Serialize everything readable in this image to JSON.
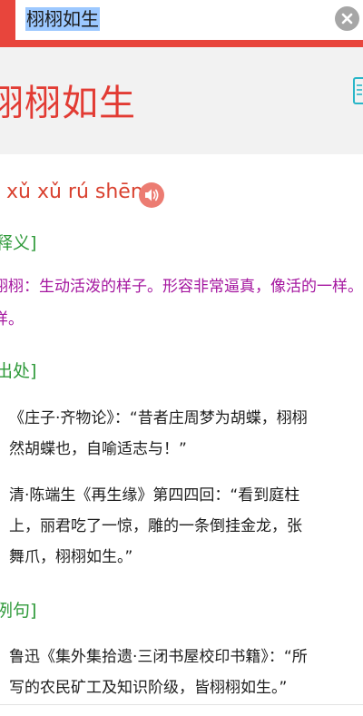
{
  "search": {
    "query": "栩栩如生"
  },
  "header": {
    "title": "栩栩如生"
  },
  "pinyin": {
    "text": "xǔ xǔ rú shēng"
  },
  "sections": {
    "definition_heading": "释义]",
    "definition_line1": "栩栩：生动活泼的样子。形容非常逼真，像活的一样。",
    "definition_line2": "样。",
    "source_heading": "出处]",
    "source1_line1": "《庄子·齐物论》：“昔者庄周梦为胡蝶，栩栩",
    "source1_line2": "然胡蝶也，自喻适志与！”",
    "source2_line1": "清·陈端生《再生缘》第四四回：“看到庭柱",
    "source2_line2": "上，丽君吃了一惊，雕的一条倒挂金龙，张",
    "source2_line3": "舞爪，栩栩如生。”",
    "example_heading": "例句]",
    "example_line1": "鲁迅《集外集拾遗·三闭书屋校印书籍》：“所",
    "example_line2": "写的农民矿工及知识阶级，皆栩栩如生。”"
  },
  "colors": {
    "accent_red": "#e8453c",
    "title_red": "#e23b33",
    "heading_green": "#2f9a3a",
    "meaning_purple": "#a4159f"
  },
  "icons": {
    "clear": "close-circle-icon",
    "speaker": "speaker-icon",
    "side": "bookmark-icon"
  }
}
